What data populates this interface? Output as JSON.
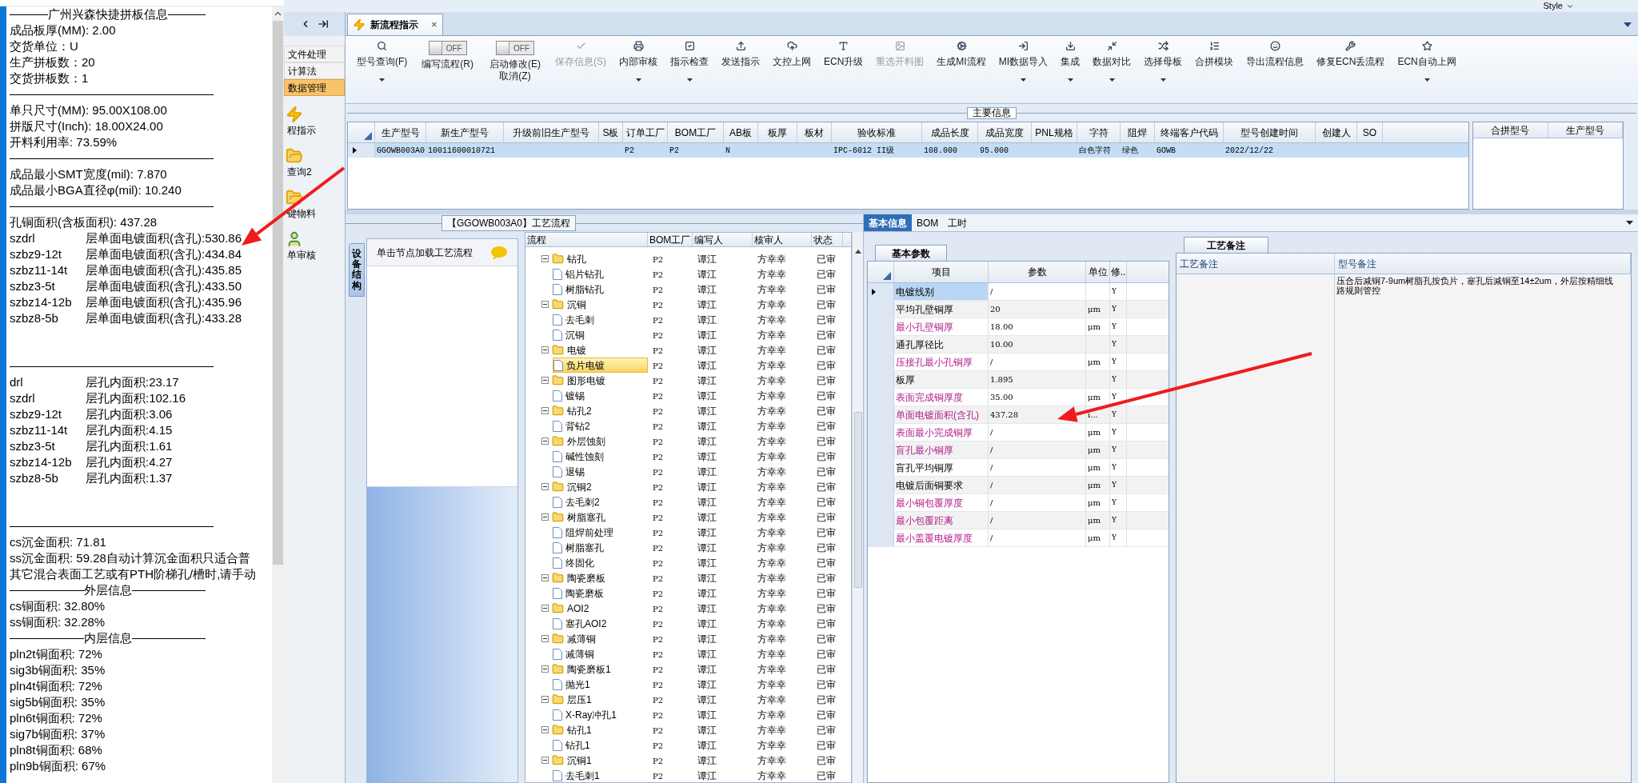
{
  "report": {
    "lines": [
      {
        "kind": "heading",
        "text": "广州兴森快捷拼板信息"
      },
      {
        "kind": "text",
        "text": "成品板厚(MM): 2.00"
      },
      {
        "kind": "text",
        "text": "交货单位：U"
      },
      {
        "kind": "text",
        "text": "生产拼板数：20"
      },
      {
        "kind": "text",
        "text": "交货拼板数：1"
      },
      {
        "kind": "rule"
      },
      {
        "kind": "text",
        "text": "单只尺寸(MM): 95.00X108.00"
      },
      {
        "kind": "text",
        "text": "拼版尺寸(Inch): 18.00X24.00"
      },
      {
        "kind": "text",
        "text": "开料利用率: 73.59%"
      },
      {
        "kind": "rule"
      },
      {
        "kind": "text",
        "text": "成品最小SMT宽度(mil): 7.870"
      },
      {
        "kind": "text",
        "text": "成品最小BGA直径φ(mil):  10.240"
      },
      {
        "kind": "rule"
      },
      {
        "kind": "text",
        "text": "孔铜面积(含板面积): 437.28"
      },
      {
        "kind": "pairs",
        "rows": [
          {
            "layer": "szdrl",
            "value": "层单面电镀面积(含孔):530.86"
          },
          {
            "layer": "szbz9-12t",
            "value": "层单面电镀面积(含孔):434.84"
          },
          {
            "layer": "szbz11-14t",
            "value": "层单面电镀面积(含孔):435.85"
          },
          {
            "layer": "szbz3-5t",
            "value": "层单面电镀面积(含孔):433.50"
          },
          {
            "layer": "szbz14-12b",
            "value": "层单面电镀面积(含孔):435.96"
          },
          {
            "layer": "szbz8-5b",
            "value": "层单面电镀面积(含孔):433.28"
          }
        ]
      },
      {
        "kind": "rule"
      },
      {
        "kind": "pairs",
        "rows": [
          {
            "layer": "drl",
            "value": "层孔内面积:23.17"
          },
          {
            "layer": "szdrl",
            "value": "层孔内面积:102.16"
          },
          {
            "layer": "szbz9-12t",
            "value": "层孔内面积:3.06"
          },
          {
            "layer": "szbz11-14t",
            "value": "层孔内面积:4.15"
          },
          {
            "layer": "szbz3-5t",
            "value": "层孔内面积:1.61"
          },
          {
            "layer": "szbz14-12b",
            "value": "层孔内面积:4.27"
          },
          {
            "layer": "szbz8-5b",
            "value": "层孔内面积:1.37"
          }
        ]
      },
      {
        "kind": "rule"
      },
      {
        "kind": "text",
        "text": "cs沉金面积: 71.81"
      },
      {
        "kind": "text",
        "text": "ss沉金面积: 59.28自动计算沉金面积只适合普"
      },
      {
        "kind": "text",
        "text": "其它混合表面工艺或有PTH阶梯孔/槽时,请手动"
      },
      {
        "kind": "heading",
        "text": "外层信息"
      },
      {
        "kind": "text",
        "text": "cs铜面积: 32.80%"
      },
      {
        "kind": "text",
        "text": "ss铜面积: 32.28%"
      },
      {
        "kind": "heading",
        "text": "内层信息"
      },
      {
        "kind": "text",
        "text": "pln2t铜面积: 72%"
      },
      {
        "kind": "text",
        "text": "sig3b铜面积: 35%"
      },
      {
        "kind": "text",
        "text": "pln4t铜面积: 72%"
      },
      {
        "kind": "text",
        "text": "sig5b铜面积: 35%"
      },
      {
        "kind": "text",
        "text": "pln6t铜面积: 72%"
      },
      {
        "kind": "text",
        "text": "sig7b铜面积: 37%"
      },
      {
        "kind": "text",
        "text": "pln8t铜面积: 68%"
      },
      {
        "kind": "text",
        "text": "pln9b铜面积: 67%"
      }
    ]
  },
  "style_menu": "Style",
  "nav": {
    "items": [
      {
        "kind": "text",
        "label": "文件处理",
        "selected": false
      },
      {
        "kind": "text",
        "label": "计算法",
        "selected": false
      },
      {
        "kind": "text",
        "label": "数据管理",
        "selected": true
      },
      {
        "kind": "icon",
        "label": "程指示",
        "selected": false
      },
      {
        "kind": "icon",
        "label": "查询2",
        "selected": false
      },
      {
        "kind": "icon",
        "label": "键物料",
        "selected": false
      },
      {
        "kind": "icon",
        "label": "单审核",
        "selected": false
      }
    ]
  },
  "document_tab": {
    "label": "新流程指示",
    "close": "×"
  },
  "toolbar": [
    {
      "kind": "button",
      "lines": [
        "型号查询(F)"
      ],
      "disabled": false,
      "dropdown": true
    },
    {
      "kind": "toggle",
      "state_text": "OFF",
      "on": false,
      "lines": [
        "编写流程(R)"
      ]
    },
    {
      "kind": "toggle",
      "state_text": "OFF",
      "on": false,
      "lines": [
        "启动修改(E)",
        "取消(Z)"
      ]
    },
    {
      "kind": "button",
      "lines": [
        "保存信息(S)"
      ],
      "disabled": true,
      "dropdown": false
    },
    {
      "kind": "button",
      "lines": [
        "内部审核"
      ],
      "disabled": false,
      "dropdown": true
    },
    {
      "kind": "button",
      "lines": [
        "指示检查"
      ],
      "disabled": false,
      "dropdown": true
    },
    {
      "kind": "button",
      "lines": [
        "发送指示"
      ],
      "disabled": false,
      "dropdown": false
    },
    {
      "kind": "button",
      "lines": [
        "文控上网"
      ],
      "disabled": false,
      "dropdown": false
    },
    {
      "kind": "button",
      "lines": [
        "ECN升级"
      ],
      "disabled": false,
      "dropdown": false
    },
    {
      "kind": "button",
      "lines": [
        "重选开料图"
      ],
      "disabled": true,
      "dropdown": false
    },
    {
      "kind": "button",
      "lines": [
        "生成MI流程"
      ],
      "disabled": false,
      "dropdown": false
    },
    {
      "kind": "button",
      "lines": [
        "MI数据导入"
      ],
      "disabled": false,
      "dropdown": true
    },
    {
      "kind": "button",
      "lines": [
        "集成"
      ],
      "disabled": false,
      "dropdown": true
    },
    {
      "kind": "button",
      "lines": [
        "数据对比"
      ],
      "disabled": false,
      "dropdown": true
    },
    {
      "kind": "button",
      "lines": [
        "选择母板"
      ],
      "disabled": false,
      "dropdown": true
    },
    {
      "kind": "button",
      "lines": [
        "合拼模块"
      ],
      "disabled": false,
      "dropdown": false
    },
    {
      "kind": "button",
      "lines": [
        "导出流程信息"
      ],
      "disabled": false,
      "dropdown": false
    },
    {
      "kind": "button",
      "lines": [
        "修复ECN丢流程"
      ],
      "disabled": false,
      "dropdown": false
    },
    {
      "kind": "button",
      "lines": [
        "ECN自动上网"
      ],
      "disabled": false,
      "dropdown": true
    }
  ],
  "main_info": {
    "title": "主要信息",
    "columns": [
      "生产型号",
      "新生产型号",
      "升级前旧生产型号",
      "S板",
      "订单工厂",
      "BOM工厂",
      "AB板",
      "板厚",
      "板材",
      "验收标准",
      "成品长度",
      "成品宽度",
      "PNL规格",
      "字符",
      "阻焊",
      "终端客户代码",
      "型号创建时间",
      "创建人",
      "SO"
    ],
    "rows": [
      {
        "selected": true,
        "cells": [
          "GGOWB003A0",
          "10011600010721",
          null,
          null,
          "P2",
          "P2",
          "N",
          null,
          null,
          "IPC-6012 II级",
          "108.000",
          "95.000",
          null,
          "白色字符",
          "绿色",
          "GOWB",
          "2022/12/22",
          null,
          null
        ]
      }
    ],
    "side_columns": [
      "合拼型号",
      "生产型号"
    ]
  },
  "process_flow": {
    "title": "【GGOWB003A0】工艺流程",
    "side_tab": "设备结构",
    "hint": "单击节点加载工艺流程",
    "columns": [
      "流程",
      "BOM工厂",
      "编写人",
      "核审人",
      "状态"
    ],
    "rows": [
      {
        "label": "钻孔",
        "bom": "P2",
        "writer": "谭江",
        "reviewer": "方幸幸",
        "status": "已审",
        "expanded": true,
        "selected": false,
        "children": [
          {
            "label": "铝片钻孔",
            "bom": "P2",
            "writer": "谭江",
            "reviewer": "方幸幸",
            "status": "已审",
            "selected": false
          },
          {
            "label": "树脂钻孔",
            "bom": "P2",
            "writer": "谭江",
            "reviewer": "方幸幸",
            "status": "已审",
            "selected": false
          }
        ]
      },
      {
        "label": "沉铜",
        "bom": "P2",
        "writer": "谭江",
        "reviewer": "方幸幸",
        "status": "已审",
        "expanded": true,
        "selected": false,
        "children": [
          {
            "label": "去毛刺",
            "bom": "P2",
            "writer": "谭江",
            "reviewer": "方幸幸",
            "status": "已审",
            "selected": false
          },
          {
            "label": "沉铜",
            "bom": "P2",
            "writer": "谭江",
            "reviewer": "方幸幸",
            "status": "已审",
            "selected": false
          }
        ]
      },
      {
        "label": "电镀",
        "bom": "P2",
        "writer": "谭江",
        "reviewer": "方幸幸",
        "status": "已审",
        "expanded": true,
        "selected": false,
        "children": [
          {
            "label": "负片电镀",
            "bom": "P2",
            "writer": "谭江",
            "reviewer": "方幸幸",
            "status": "已审",
            "selected": true
          }
        ]
      },
      {
        "label": "图形电镀",
        "bom": "P2",
        "writer": "谭江",
        "reviewer": "方幸幸",
        "status": "已审",
        "expanded": true,
        "selected": false,
        "children": [
          {
            "label": "镀锡",
            "bom": "P2",
            "writer": "谭江",
            "reviewer": "方幸幸",
            "status": "已审",
            "selected": false
          }
        ]
      },
      {
        "label": "钻孔2",
        "bom": "P2",
        "writer": "谭江",
        "reviewer": "方幸幸",
        "status": "已审",
        "expanded": true,
        "selected": false,
        "children": [
          {
            "label": "背钻2",
            "bom": "P2",
            "writer": "谭江",
            "reviewer": "方幸幸",
            "status": "已审",
            "selected": false
          }
        ]
      },
      {
        "label": "外层蚀刻",
        "bom": "P2",
        "writer": "谭江",
        "reviewer": "方幸幸",
        "status": "已审",
        "expanded": true,
        "selected": false,
        "children": [
          {
            "label": "碱性蚀刻",
            "bom": "P2",
            "writer": "谭江",
            "reviewer": "方幸幸",
            "status": "已审",
            "selected": false
          },
          {
            "label": "退锡",
            "bom": "P2",
            "writer": "谭江",
            "reviewer": "方幸幸",
            "status": "已审",
            "selected": false
          }
        ]
      },
      {
        "label": "沉铜2",
        "bom": "P2",
        "writer": "谭江",
        "reviewer": "方幸幸",
        "status": "已审",
        "expanded": true,
        "selected": false,
        "children": [
          {
            "label": "去毛刺2",
            "bom": "P2",
            "writer": "谭江",
            "reviewer": "方幸幸",
            "status": "已审",
            "selected": false
          }
        ]
      },
      {
        "label": "树脂塞孔",
        "bom": "P2",
        "writer": "谭江",
        "reviewer": "方幸幸",
        "status": "已审",
        "expanded": true,
        "selected": false,
        "children": [
          {
            "label": "阻焊前处理",
            "bom": "P2",
            "writer": "谭江",
            "reviewer": "方幸幸",
            "status": "已审",
            "selected": false
          },
          {
            "label": "树脂塞孔",
            "bom": "P2",
            "writer": "谭江",
            "reviewer": "方幸幸",
            "status": "已审",
            "selected": false
          },
          {
            "label": "终固化",
            "bom": "P2",
            "writer": "谭江",
            "reviewer": "方幸幸",
            "status": "已审",
            "selected": false
          }
        ]
      },
      {
        "label": "陶瓷磨板",
        "bom": "P2",
        "writer": "谭江",
        "reviewer": "方幸幸",
        "status": "已审",
        "expanded": true,
        "selected": false,
        "children": [
          {
            "label": "陶瓷磨板",
            "bom": "P2",
            "writer": "谭江",
            "reviewer": "方幸幸",
            "status": "已审",
            "selected": false
          }
        ]
      },
      {
        "label": "AOI2",
        "bom": "P2",
        "writer": "谭江",
        "reviewer": "方幸幸",
        "status": "已审",
        "expanded": true,
        "selected": false,
        "children": [
          {
            "label": "塞孔AOI2",
            "bom": "P2",
            "writer": "谭江",
            "reviewer": "方幸幸",
            "status": "已审",
            "selected": false
          }
        ]
      },
      {
        "label": "减薄铜",
        "bom": "P2",
        "writer": "谭江",
        "reviewer": "方幸幸",
        "status": "已审",
        "expanded": true,
        "selected": false,
        "children": [
          {
            "label": "减薄铜",
            "bom": "P2",
            "writer": "谭江",
            "reviewer": "方幸幸",
            "status": "已审",
            "selected": false
          }
        ]
      },
      {
        "label": "陶瓷磨板1",
        "bom": "P2",
        "writer": "谭江",
        "reviewer": "方幸幸",
        "status": "已审",
        "expanded": true,
        "selected": false,
        "children": [
          {
            "label": "抛光1",
            "bom": "P2",
            "writer": "谭江",
            "reviewer": "方幸幸",
            "status": "已审",
            "selected": false
          }
        ]
      },
      {
        "label": "层压1",
        "bom": "P2",
        "writer": "谭江",
        "reviewer": "方幸幸",
        "status": "已审",
        "expanded": true,
        "selected": false,
        "children": [
          {
            "label": "X-Ray冲孔1",
            "bom": "P2",
            "writer": "谭江",
            "reviewer": "方幸幸",
            "status": "已审",
            "selected": false
          }
        ]
      },
      {
        "label": "钻孔1",
        "bom": "P2",
        "writer": "谭江",
        "reviewer": "方幸幸",
        "status": "已审",
        "expanded": true,
        "selected": false,
        "children": [
          {
            "label": "钻孔1",
            "bom": "P2",
            "writer": "谭江",
            "reviewer": "方幸幸",
            "status": "已审",
            "selected": false
          }
        ]
      },
      {
        "label": "沉铜1",
        "bom": "P2",
        "writer": "谭江",
        "reviewer": "方幸幸",
        "status": "已审",
        "expanded": true,
        "selected": false,
        "children": [
          {
            "label": "去毛刺1",
            "bom": "P2",
            "writer": "谭江",
            "reviewer": "方幸幸",
            "status": "已审",
            "selected": false
          }
        ]
      }
    ]
  },
  "detail": {
    "tabs": [
      {
        "label": "基本信息",
        "selected": true
      },
      {
        "label": "BOM",
        "selected": false
      },
      {
        "label": "工时",
        "selected": false
      }
    ],
    "params": {
      "tab": "基本参数",
      "columns": [
        "项目",
        "参数",
        "单位",
        "修.."
      ],
      "rows": [
        {
          "item": "电镀线别",
          "value": "/",
          "flag": "Y",
          "highlighted": false,
          "selected": true
        },
        {
          "item": "平均孔壁铜厚",
          "value": "20",
          "unit": "μm",
          "flag": "Y",
          "highlighted": false,
          "selected": false
        },
        {
          "item": "最小孔壁铜厚",
          "value": "18.00",
          "unit": "μm",
          "flag": "Y",
          "highlighted": true,
          "selected": false
        },
        {
          "item": "通孔厚径比",
          "value": "10.00",
          "flag": "Y",
          "highlighted": false,
          "selected": false
        },
        {
          "item": "压接孔最小孔铜厚",
          "value": "/",
          "unit": "μm",
          "flag": "Y",
          "highlighted": true,
          "selected": false
        },
        {
          "item": "板厚",
          "value": "1.895",
          "flag": "Y",
          "highlighted": false,
          "selected": false
        },
        {
          "item": "表面完成铜厚度",
          "value": "35.00",
          "unit": "μm",
          "flag": "Y",
          "highlighted": true,
          "selected": false
        },
        {
          "item": "单面电镀面积(含孔)",
          "value": "437.28",
          "unit": "i...",
          "flag": "Y",
          "highlighted": true,
          "selected": false
        },
        {
          "item": "表面最小完成铜厚",
          "value": "/",
          "unit": "μm",
          "flag": "Y",
          "highlighted": true,
          "selected": false
        },
        {
          "item": "盲孔最小铜厚",
          "value": "/",
          "unit": "μm",
          "flag": "Y",
          "highlighted": true,
          "selected": false
        },
        {
          "item": "盲孔平均铜厚",
          "value": "/",
          "unit": "μm",
          "flag": "Y",
          "highlighted": false,
          "selected": false
        },
        {
          "item": "电镀后面铜要求",
          "value": "/",
          "unit": "μm",
          "flag": "Y",
          "highlighted": false,
          "selected": false
        },
        {
          "item": "最小铜包覆厚度",
          "value": "/",
          "unit": "μm",
          "flag": "Y",
          "highlighted": true,
          "selected": false
        },
        {
          "item": "最小包覆距离",
          "value": "/",
          "unit": "μm",
          "flag": "Y",
          "highlighted": true,
          "selected": false
        },
        {
          "item": "最小盖覆电镀厚度",
          "value": "/",
          "unit": "μm",
          "flag": "Y",
          "highlighted": true,
          "selected": false
        }
      ]
    },
    "notes": {
      "tab": "工艺备注",
      "columns": [
        "工艺备注",
        "型号备注"
      ],
      "model_note": "压合后减铜7-9um树脂孔按负片，塞孔后减铜至14±2um，外层按精细线路规则管控"
    }
  }
}
